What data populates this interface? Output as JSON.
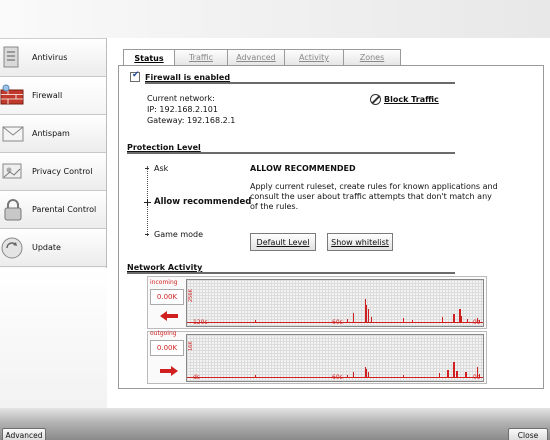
{
  "sidebar": {
    "items": [
      {
        "label": "Antivirus",
        "icon": "antivirus-icon"
      },
      {
        "label": "Firewall",
        "icon": "firewall-icon"
      },
      {
        "label": "Antispam",
        "icon": "antispam-icon"
      },
      {
        "label": "Privacy Control",
        "icon": "privacy-icon"
      },
      {
        "label": "Parental Control",
        "icon": "parental-icon"
      },
      {
        "label": "Update",
        "icon": "update-icon"
      }
    ]
  },
  "tabs": [
    {
      "label": "Status",
      "active": true
    },
    {
      "label": "Traffic",
      "active": false
    },
    {
      "label": "Advanced",
      "active": false
    },
    {
      "label": "Activity",
      "active": false
    },
    {
      "label": "Zones",
      "active": false
    }
  ],
  "status": {
    "firewall_enabled_label": "Firewall is enabled",
    "firewall_enabled": true,
    "current_network_label": "Current network:",
    "ip_label": "IP: 192.168.2.101",
    "gateway_label": "Gateway: 192.168.2.1",
    "block_traffic_label": "Block Traffic"
  },
  "protection": {
    "title": "Protection Level",
    "levels": [
      "Ask",
      "Allow recommended",
      "Game mode"
    ],
    "selected_level": "Allow recommended",
    "selected_title": "ALLOW RECOMMENDED",
    "description": "Apply current ruleset, create rules for known applications and consult the user about traffic attempts that don't match any of the rules.",
    "default_level_button": "Default Level",
    "show_whitelist_button": "Show whitelist"
  },
  "network_activity": {
    "title": "Network Activity",
    "incoming": {
      "label": "incoming",
      "value": "0.00K",
      "scale": "256K",
      "ticks": [
        "120s",
        "60s",
        "0s"
      ],
      "bars": [
        {
          "t": 0.23,
          "h": 0.06
        },
        {
          "t": 0.54,
          "h": 0.08
        },
        {
          "t": 0.56,
          "h": 0.22
        },
        {
          "t": 0.6,
          "h": 0.58
        },
        {
          "t": 0.605,
          "h": 0.42
        },
        {
          "t": 0.61,
          "h": 0.32
        },
        {
          "t": 0.62,
          "h": 0.12
        },
        {
          "t": 0.73,
          "h": 0.1
        },
        {
          "t": 0.76,
          "h": 0.06
        },
        {
          "t": 0.86,
          "h": 0.12
        },
        {
          "t": 0.9,
          "h": 0.2
        },
        {
          "t": 0.92,
          "h": 0.32
        },
        {
          "t": 0.925,
          "h": 0.14
        },
        {
          "t": 0.945,
          "h": 0.08
        },
        {
          "t": 0.98,
          "h": 0.1
        },
        {
          "t": 0.985,
          "h": 0.06
        }
      ]
    },
    "outgoing": {
      "label": "outgoing",
      "value": "0.00K",
      "scale": "16K",
      "ticks": [
        "ds",
        "60s",
        "0s"
      ],
      "bars": [
        {
          "t": 0.23,
          "h": 0.06
        },
        {
          "t": 0.54,
          "h": 0.06
        },
        {
          "t": 0.56,
          "h": 0.12
        },
        {
          "t": 0.6,
          "h": 0.26
        },
        {
          "t": 0.605,
          "h": 0.2
        },
        {
          "t": 0.61,
          "h": 0.12
        },
        {
          "t": 0.73,
          "h": 0.06
        },
        {
          "t": 0.85,
          "h": 0.1
        },
        {
          "t": 0.88,
          "h": 0.18
        },
        {
          "t": 0.9,
          "h": 0.38
        },
        {
          "t": 0.91,
          "h": 0.16
        },
        {
          "t": 0.94,
          "h": 0.12
        },
        {
          "t": 0.98,
          "h": 0.24
        },
        {
          "t": 0.985,
          "h": 0.08
        }
      ]
    }
  },
  "bottom": {
    "advanced_button": "Advanced",
    "close_button": "Close"
  },
  "colors": {
    "graph_red": "#d01f1f",
    "border_gray": "#9a9a9a"
  }
}
